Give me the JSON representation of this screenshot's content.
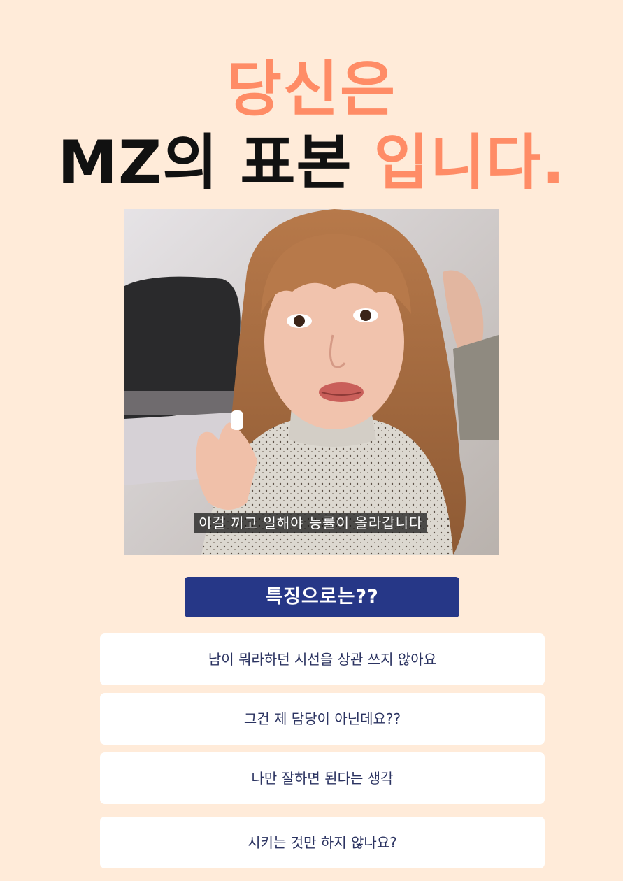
{
  "title": {
    "line1": "당신은",
    "line2_main": "MZ의 표본",
    "line2_accent": "입니다."
  },
  "photo": {
    "subtitle": "이걸 끼고 일해야 능률이 올라갑니다"
  },
  "features": {
    "heading": "특징으로는??",
    "items": [
      "남이 뭐라하던 시선을 상관 쓰지 않아요",
      "그건 제 담당이 아닌데요??",
      "나만 잘하면 된다는 생각",
      "시키는 것만 하지 않나요?"
    ]
  },
  "colors": {
    "background": "#ffebd9",
    "accent": "#ff8c66",
    "heading_button": "#263787",
    "card_text": "#2b3361"
  }
}
